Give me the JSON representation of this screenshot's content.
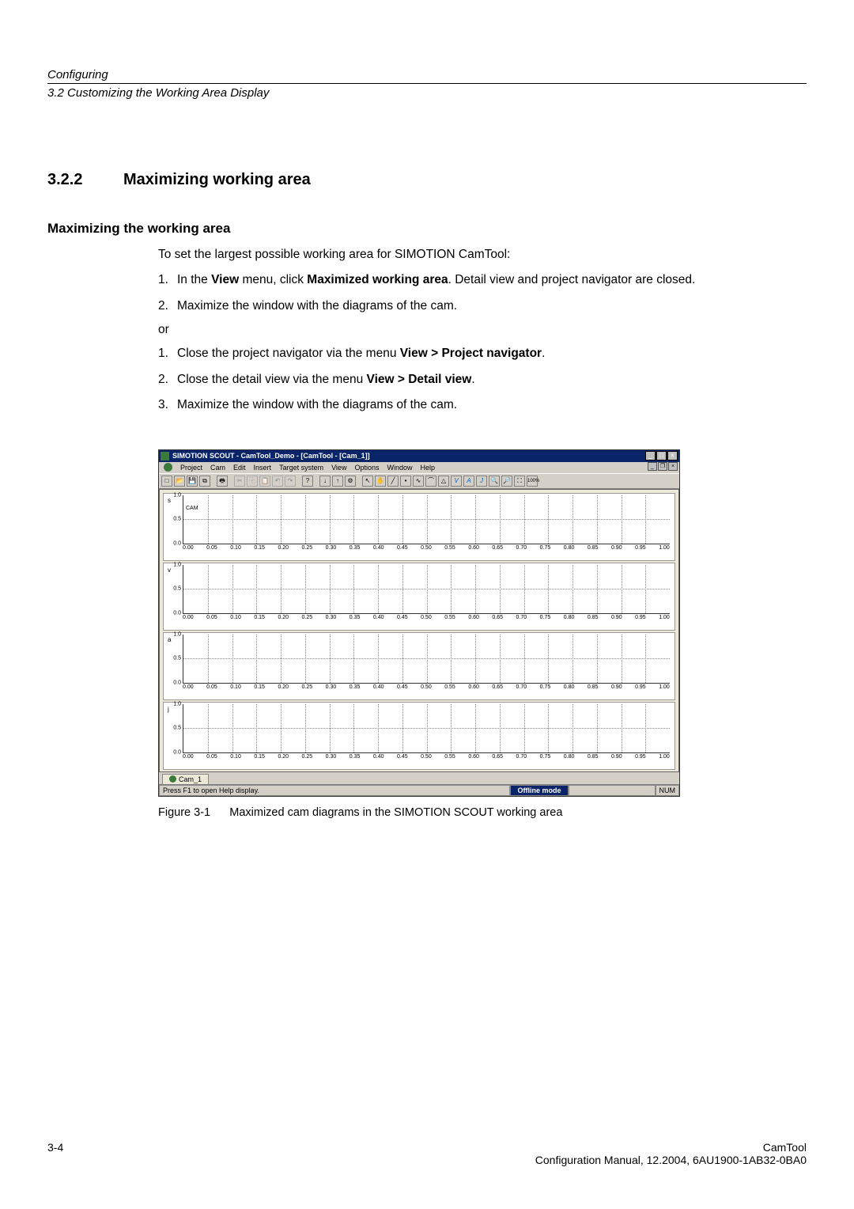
{
  "header": {
    "chapter": "Configuring",
    "section_ref": "3.2 Customizing the Working Area Display"
  },
  "section": {
    "number": "3.2.2",
    "title": "Maximizing working area"
  },
  "content": {
    "subhead": "Maximizing the working area",
    "intro": "To set the largest possible working area for SIMOTION CamTool:",
    "list1": [
      {
        "n": "1.",
        "pre": "In the ",
        "b1": "View",
        "mid1": " menu, click ",
        "b2": "Maximized working area",
        "post": ". Detail view and project navigator are closed."
      },
      {
        "n": "2.",
        "pre": "Maximize the window with the diagrams of the cam.",
        "b1": "",
        "mid1": "",
        "b2": "",
        "post": ""
      }
    ],
    "or": "or",
    "list2": [
      {
        "n": "1.",
        "pre": "Close the project navigator via the menu ",
        "b1": "View > Project navigator",
        "post": "."
      },
      {
        "n": "2.",
        "pre": "Close the detail view via the menu ",
        "b1": "View > Detail view",
        "post": "."
      },
      {
        "n": "3.",
        "pre": "Maximize the window with the diagrams of the cam.",
        "b1": "",
        "post": ""
      }
    ]
  },
  "figure": {
    "title": "SIMOTION SCOUT - CamTool_Demo - [CamTool - [Cam_1]]",
    "menus": [
      "Project",
      "Cam",
      "Edit",
      "Insert",
      "Target system",
      "View",
      "Options",
      "Window",
      "Help"
    ],
    "charts": [
      "s",
      "v",
      "a",
      "j"
    ],
    "camlabel": "CAM",
    "yticks": [
      "1.0",
      "0.5",
      "0.0"
    ],
    "xticks": [
      "0.00",
      "0.05",
      "0.10",
      "0.15",
      "0.20",
      "0.25",
      "0.30",
      "0.35",
      "0.40",
      "0.45",
      "0.50",
      "0.55",
      "0.60",
      "0.65",
      "0.70",
      "0.75",
      "0.80",
      "0.85",
      "0.90",
      "0.95",
      "1.00"
    ],
    "tab": "Cam_1",
    "status_help": "Press F1 to open Help display.",
    "status_offline": "Offline mode",
    "status_num": "NUM",
    "caption_label": "Figure 3-1",
    "caption_text": "Maximized cam diagrams in the SIMOTION SCOUT working area"
  },
  "footer": {
    "page": "3-4",
    "product": "CamTool",
    "docinfo": "Configuration Manual, 12.2004, 6AU1900-1AB32-0BA0"
  },
  "chart_data": [
    {
      "type": "line",
      "title": "s",
      "x": [
        0.0,
        1.0
      ],
      "y": [],
      "xlim": [
        0,
        1
      ],
      "ylim": [
        0,
        1
      ],
      "xticks": [
        0.0,
        0.05,
        0.1,
        0.15,
        0.2,
        0.25,
        0.3,
        0.35,
        0.4,
        0.45,
        0.5,
        0.55,
        0.6,
        0.65,
        0.7,
        0.75,
        0.8,
        0.85,
        0.9,
        0.95,
        1.0
      ],
      "yticks": [
        0.0,
        0.5,
        1.0
      ],
      "annotation": "CAM"
    },
    {
      "type": "line",
      "title": "v",
      "x": [
        0.0,
        1.0
      ],
      "y": [],
      "xlim": [
        0,
        1
      ],
      "ylim": [
        0,
        1
      ],
      "xticks": [
        0.0,
        0.05,
        0.1,
        0.15,
        0.2,
        0.25,
        0.3,
        0.35,
        0.4,
        0.45,
        0.5,
        0.55,
        0.6,
        0.65,
        0.7,
        0.75,
        0.8,
        0.85,
        0.9,
        0.95,
        1.0
      ],
      "yticks": [
        0.0,
        0.5,
        1.0
      ]
    },
    {
      "type": "line",
      "title": "a",
      "x": [
        0.0,
        1.0
      ],
      "y": [],
      "xlim": [
        0,
        1
      ],
      "ylim": [
        0,
        1
      ],
      "xticks": [
        0.0,
        0.05,
        0.1,
        0.15,
        0.2,
        0.25,
        0.3,
        0.35,
        0.4,
        0.45,
        0.5,
        0.55,
        0.6,
        0.65,
        0.7,
        0.75,
        0.8,
        0.85,
        0.9,
        0.95,
        1.0
      ],
      "yticks": [
        0.0,
        0.5,
        1.0
      ]
    },
    {
      "type": "line",
      "title": "j",
      "x": [
        0.0,
        1.0
      ],
      "y": [],
      "xlim": [
        0,
        1
      ],
      "ylim": [
        0,
        1
      ],
      "xticks": [
        0.0,
        0.05,
        0.1,
        0.15,
        0.2,
        0.25,
        0.3,
        0.35,
        0.4,
        0.45,
        0.5,
        0.55,
        0.6,
        0.65,
        0.7,
        0.75,
        0.8,
        0.85,
        0.9,
        0.95,
        1.0
      ],
      "yticks": [
        0.0,
        0.5,
        1.0
      ]
    }
  ]
}
